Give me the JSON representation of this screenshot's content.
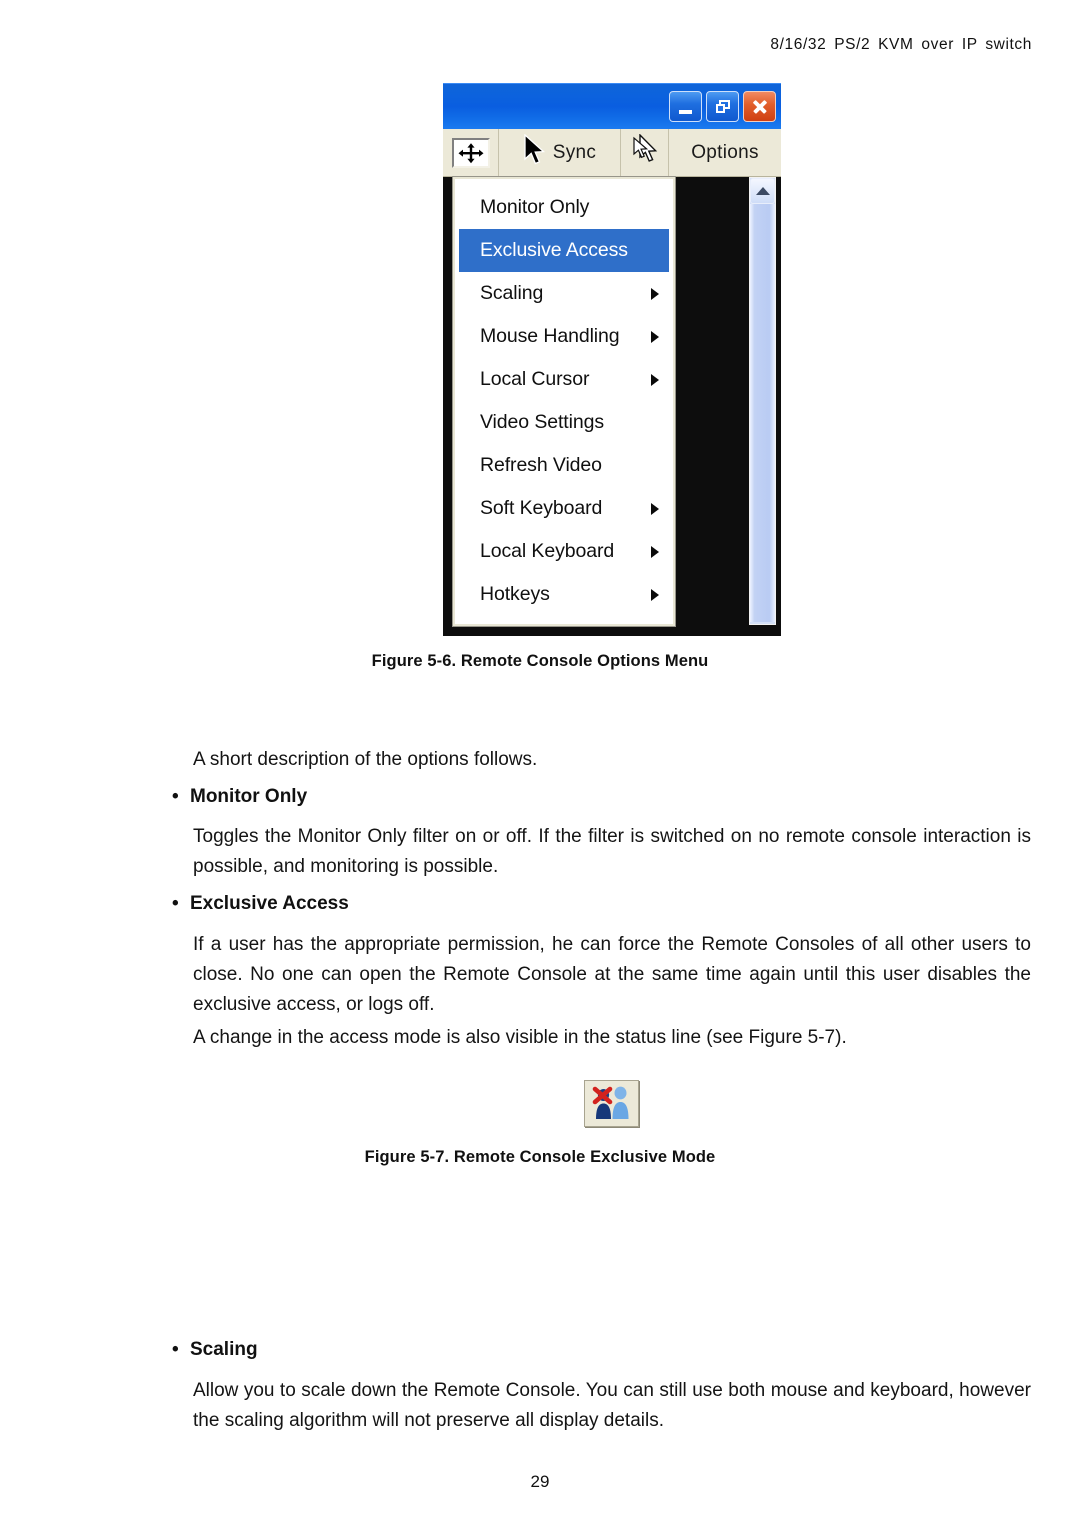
{
  "page": {
    "header": "8/16/32 PS/2 KVM over IP switch",
    "number": "29"
  },
  "remote_console_window": {
    "titlebar": {
      "minimize_label": "Minimize",
      "restore_label": "Restore",
      "close_label": "Close"
    },
    "toolbar": {
      "resize_icon": "fit-to-screen-icon",
      "sync_icon": "mouse-cursor-icon",
      "sync_label": "Sync",
      "cursor_icon": "double-mouse-cursor-icon",
      "options_label": "Options"
    },
    "options_menu": {
      "items": [
        {
          "label": "Monitor Only",
          "submenu": false,
          "selected": false
        },
        {
          "label": "Exclusive Access",
          "submenu": false,
          "selected": true
        },
        {
          "label": "Scaling",
          "submenu": true,
          "selected": false
        },
        {
          "label": "Mouse Handling",
          "submenu": true,
          "selected": false
        },
        {
          "label": "Local Cursor",
          "submenu": true,
          "selected": false
        },
        {
          "label": "Video Settings",
          "submenu": false,
          "selected": false
        },
        {
          "label": "Refresh Video",
          "submenu": false,
          "selected": false
        },
        {
          "label": "Soft Keyboard",
          "submenu": true,
          "selected": false
        },
        {
          "label": "Local Keyboard",
          "submenu": true,
          "selected": false
        },
        {
          "label": "Hotkeys",
          "submenu": true,
          "selected": false
        }
      ],
      "highlight_color": "#2f6fc9",
      "highlight_text_color": "#ffffff"
    },
    "scrollbar": {
      "up_arrow_icon": "chevron-up-icon"
    }
  },
  "figures": {
    "fig56_caption": "Figure 5-6. Remote Console Options Menu",
    "fig57_caption": "Figure 5-7. Remote Console Exclusive Mode",
    "fig57_icon_name": "exclusive-mode-icon"
  },
  "content": {
    "intro": "A short description of the options follows.",
    "sections": [
      {
        "heading": "Monitor Only",
        "body": "Toggles the Monitor Only filter on or off. If the filter is switched on no remote console interaction is possible, and monitoring is possible."
      },
      {
        "heading": "Exclusive Access",
        "body": "If a user has the appropriate permission, he can force the Remote Consoles of all other users to close. No one can open the Remote Console at the same time again until this user disables the exclusive access, or logs off.",
        "body2": "A change in the access mode is also visible in the status line (see Figure 5-7)."
      },
      {
        "heading": "Scaling",
        "body": "Allow you to scale down the Remote Console. You can still use both mouse and keyboard, however the scaling algorithm will not preserve all display details."
      }
    ]
  }
}
